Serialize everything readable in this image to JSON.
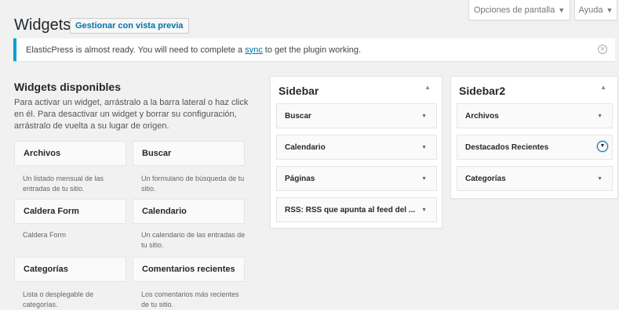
{
  "screen_meta": {
    "screen_options": "Opciones de pantalla",
    "help": "Ayuda",
    "arrow": "▼"
  },
  "header": {
    "title": "Widgets",
    "preview_button": "Gestionar con vista previa"
  },
  "notice": {
    "before": "ElasticPress is almost ready. You will need to complete a",
    "link": "sync",
    "after": "to get the plugin working."
  },
  "available": {
    "title": "Widgets disponibles",
    "description": "Para activar un widget, arrástralo a la barra lateral o haz click en él. Para desactivar un widget y borrar su configuración, arrástralo de vuelta a su lugar de origen.",
    "widgets": [
      {
        "name": "Archivos",
        "desc": "Un listado mensual de las entradas de tu sitio."
      },
      {
        "name": "Buscar",
        "desc": "Un formulario de búsqueda de tu sitio."
      },
      {
        "name": "Caldera Form",
        "desc": "Caldera Form"
      },
      {
        "name": "Calendario",
        "desc": "Un calendario de las entradas de tu sitio."
      },
      {
        "name": "Categorías",
        "desc": "Lista o desplegable de categorías."
      },
      {
        "name": "Comentarios recientes",
        "desc": "Los comentarios más recientes de tu sitio."
      }
    ]
  },
  "sidebars": [
    {
      "title": "Sidebar",
      "toggle": "▲",
      "widgets": [
        "Buscar",
        "Calendario",
        "Páginas",
        "RSS: RSS que apunta al feed del ..."
      ]
    },
    {
      "title": "Sidebar2",
      "toggle": "▲",
      "widgets": [
        "Archivos",
        "Destacados Recientes",
        "Categorías"
      ]
    }
  ],
  "caret": "▼"
}
